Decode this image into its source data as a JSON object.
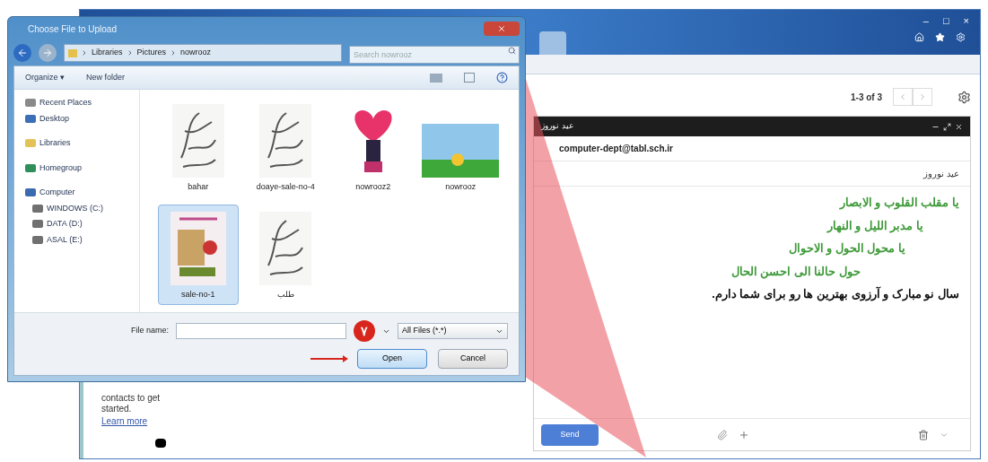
{
  "browser": {
    "window_controls": [
      "–",
      "□",
      "×"
    ]
  },
  "gmail": {
    "left_panel": {
      "text": "contacts to get started.",
      "link": "Learn more"
    },
    "pagination": "1-3 of 3",
    "compose": {
      "header_title": "عید نوروز",
      "recipient": "computer-dept@tabl.sch.ir",
      "subject": "عید نوروز",
      "body": [
        {
          "text": "یا مقلب القلوب و الابصار",
          "color": "#3f9a3a"
        },
        {
          "text": "یا مدبر اللیل و النهار",
          "color": "#3f9a3a"
        },
        {
          "text": "یا محول الحول و الاحوال",
          "color": "#3f9a3a"
        },
        {
          "text": "حول حالنا الی احسن الحال",
          "color": "#3f9a3a"
        },
        {
          "text": "سال نو مبارک و آرزوی بهترین ها رو برای شما دارم.",
          "color": "#111111"
        }
      ],
      "send": "Send"
    }
  },
  "dialog": {
    "title": "Choose File to Upload",
    "path": [
      "Libraries",
      "Pictures",
      "nowrooz"
    ],
    "search": {
      "placeholder": "Search nowrooz"
    },
    "toolbar": [
      "Organize ▾",
      "New folder"
    ],
    "nav": [
      {
        "label": "Recent Places",
        "kind": "place"
      },
      {
        "label": "Desktop",
        "kind": "desktop"
      },
      {
        "label": "Libraries",
        "kind": "library"
      },
      {
        "label": "Homegroup",
        "kind": "homegroup"
      },
      {
        "label": "Computer",
        "kind": "computer"
      },
      {
        "label": "WINDOWS (C:)",
        "kind": "drive"
      },
      {
        "label": "DATA (D:)",
        "kind": "drive"
      },
      {
        "label": "ASAL (E:)",
        "kind": "drive"
      }
    ],
    "files": [
      {
        "name": "bahar",
        "kind": "calligraphy",
        "selected": false
      },
      {
        "name": "doaye-sale-no-4",
        "kind": "calligraphy",
        "selected": false
      },
      {
        "name": "nowrooz2",
        "kind": "heart",
        "selected": false
      },
      {
        "name": "nowrooz",
        "kind": "landscape",
        "selected": false
      },
      {
        "name": "sale-no-1",
        "kind": "card",
        "selected": true
      },
      {
        "name": "طلب",
        "kind": "calligraphy",
        "selected": false
      }
    ],
    "file_name_label": "File name:",
    "file_type": "All Files (*.*)",
    "open": "Open",
    "cancel": "Cancel",
    "step_badge": "۷"
  }
}
